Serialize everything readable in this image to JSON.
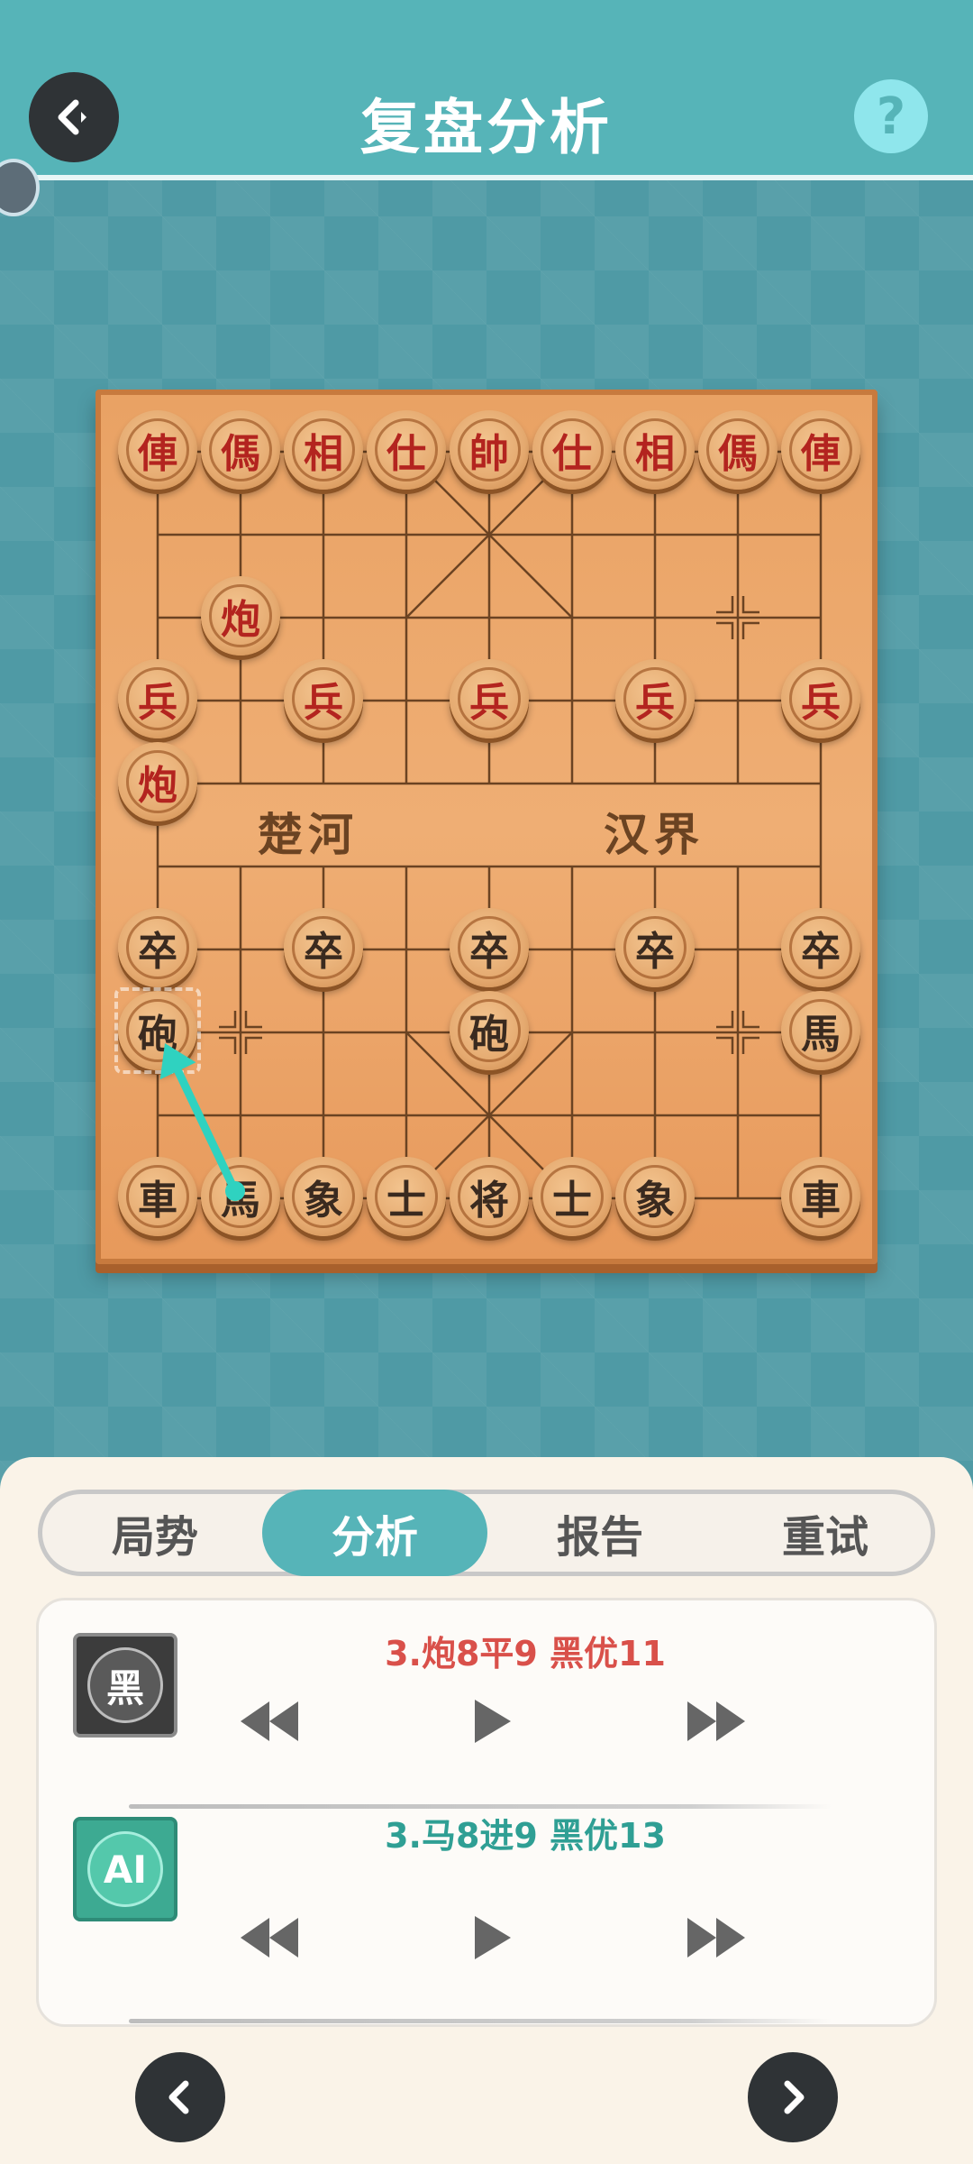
{
  "header": {
    "title": "复盘分析",
    "help_label": "?"
  },
  "board": {
    "river_left": "楚河",
    "river_right": "汉界",
    "pieces": [
      {
        "char": "俥",
        "side": "red",
        "col": 0,
        "row": 0
      },
      {
        "char": "傌",
        "side": "red",
        "col": 1,
        "row": 0
      },
      {
        "char": "相",
        "side": "red",
        "col": 2,
        "row": 0
      },
      {
        "char": "仕",
        "side": "red",
        "col": 3,
        "row": 0
      },
      {
        "char": "帥",
        "side": "red",
        "col": 4,
        "row": 0
      },
      {
        "char": "仕",
        "side": "red",
        "col": 5,
        "row": 0
      },
      {
        "char": "相",
        "side": "red",
        "col": 6,
        "row": 0
      },
      {
        "char": "傌",
        "side": "red",
        "col": 7,
        "row": 0
      },
      {
        "char": "俥",
        "side": "red",
        "col": 8,
        "row": 0
      },
      {
        "char": "炮",
        "side": "red",
        "col": 1,
        "row": 2
      },
      {
        "char": "兵",
        "side": "red",
        "col": 0,
        "row": 3
      },
      {
        "char": "兵",
        "side": "red",
        "col": 2,
        "row": 3
      },
      {
        "char": "兵",
        "side": "red",
        "col": 4,
        "row": 3
      },
      {
        "char": "兵",
        "side": "red",
        "col": 6,
        "row": 3
      },
      {
        "char": "兵",
        "side": "red",
        "col": 8,
        "row": 3
      },
      {
        "char": "炮",
        "side": "red",
        "col": 0,
        "row": 4
      },
      {
        "char": "卒",
        "side": "black",
        "col": 0,
        "row": 6
      },
      {
        "char": "卒",
        "side": "black",
        "col": 2,
        "row": 6
      },
      {
        "char": "卒",
        "side": "black",
        "col": 4,
        "row": 6
      },
      {
        "char": "卒",
        "side": "black",
        "col": 6,
        "row": 6
      },
      {
        "char": "卒",
        "side": "black",
        "col": 8,
        "row": 6
      },
      {
        "char": "砲",
        "side": "black",
        "col": 0,
        "row": 7
      },
      {
        "char": "砲",
        "side": "black",
        "col": 4,
        "row": 7
      },
      {
        "char": "馬",
        "side": "black",
        "col": 8,
        "row": 7
      },
      {
        "char": "車",
        "side": "black",
        "col": 0,
        "row": 9
      },
      {
        "char": "馬",
        "side": "black",
        "col": 1,
        "row": 9
      },
      {
        "char": "象",
        "side": "black",
        "col": 2,
        "row": 9
      },
      {
        "char": "士",
        "side": "black",
        "col": 3,
        "row": 9
      },
      {
        "char": "将",
        "side": "black",
        "col": 4,
        "row": 9
      },
      {
        "char": "士",
        "side": "black",
        "col": 5,
        "row": 9
      },
      {
        "char": "象",
        "side": "black",
        "col": 6,
        "row": 9
      },
      {
        "char": "車",
        "side": "black",
        "col": 8,
        "row": 9
      }
    ],
    "arrow_from": {
      "col": 1,
      "row": 9
    },
    "arrow_to": {
      "col": 0,
      "row": 7
    },
    "arrow_color": "#2fd2c0"
  },
  "tabs": [
    {
      "label": "局势",
      "active": false
    },
    {
      "label": "分析",
      "active": true
    },
    {
      "label": "报告",
      "active": false
    },
    {
      "label": "重试",
      "active": false
    }
  ],
  "analysis": {
    "player": {
      "avatar_label": "黑",
      "move_text": "3.炮8平9 黑优11"
    },
    "ai": {
      "avatar_label": "AI",
      "move_text": "3.马8进9 黑优13"
    }
  },
  "colors": {
    "accent": "#56b4b8",
    "red_text": "#d9504a",
    "teal_text": "#2f9f94"
  }
}
